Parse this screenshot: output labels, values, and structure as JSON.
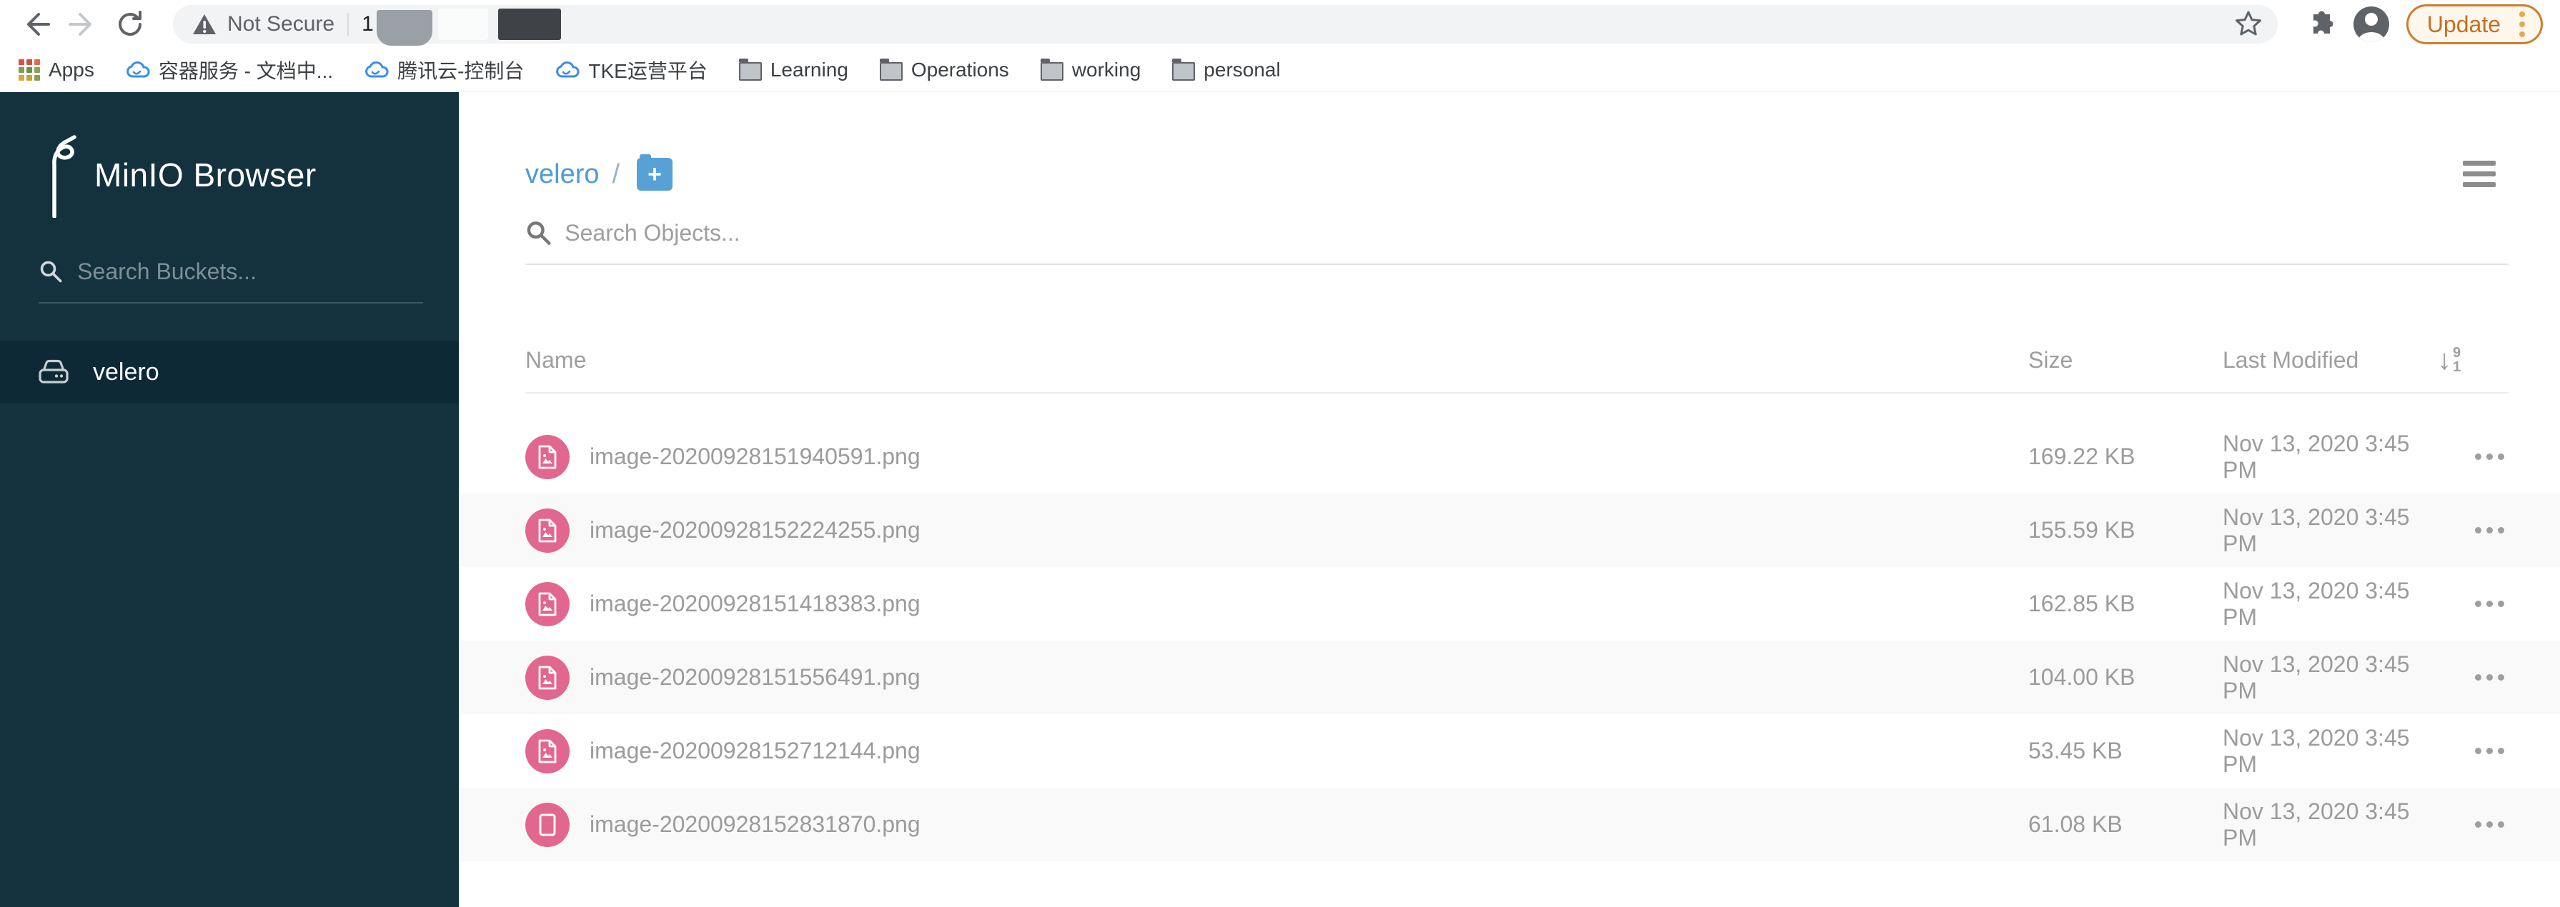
{
  "chrome": {
    "security_label": "Not Secure",
    "url_visible_fragment": "1",
    "update_button": "Update",
    "apps_label": "Apps",
    "bookmarks": [
      {
        "label": "容器服务 - 文档中...",
        "icon": "cloud"
      },
      {
        "label": "腾讯云-控制台",
        "icon": "cloud"
      },
      {
        "label": "TKE运营平台",
        "icon": "cloud"
      },
      {
        "label": "Learning",
        "icon": "folder"
      },
      {
        "label": "Operations",
        "icon": "folder"
      },
      {
        "label": "working",
        "icon": "folder"
      },
      {
        "label": "personal",
        "icon": "folder"
      }
    ]
  },
  "sidebar": {
    "title": "MinIO Browser",
    "search_placeholder": "Search Buckets...",
    "buckets": [
      {
        "name": "velero",
        "selected": true
      }
    ]
  },
  "main": {
    "breadcrumb": {
      "bucket": "velero",
      "separator": "/"
    },
    "search_placeholder": "Search Objects...",
    "table": {
      "headers": {
        "name": "Name",
        "size": "Size",
        "modified": "Last Modified"
      },
      "sort_icon": {
        "arrow": "↓",
        "top": "9",
        "bottom": "1"
      },
      "rows": [
        {
          "name": "image-20200928151940591.png",
          "size": "169.22 KB",
          "modified": "Nov 13, 2020 3:45 PM",
          "icon": "image-file"
        },
        {
          "name": "image-20200928152224255.png",
          "size": "155.59 KB",
          "modified": "Nov 13, 2020 3:45 PM",
          "icon": "image-file"
        },
        {
          "name": "image-20200928151418383.png",
          "size": "162.85 KB",
          "modified": "Nov 13, 2020 3:45 PM",
          "icon": "image-file"
        },
        {
          "name": "image-20200928151556491.png",
          "size": "104.00 KB",
          "modified": "Nov 13, 2020 3:45 PM",
          "icon": "image-file"
        },
        {
          "name": "image-20200928152712144.png",
          "size": "53.45 KB",
          "modified": "Nov 13, 2020 3:45 PM",
          "icon": "image-file"
        },
        {
          "name": "image-20200928152831870.png",
          "size": "61.08 KB",
          "modified": "Nov 13, 2020 3:45 PM",
          "icon": "plain-file"
        }
      ]
    }
  },
  "colors": {
    "sidebar_bg": "#13323e",
    "sidebar_selected_bg": "#0d2935",
    "accent_blue": "#4f9bd5",
    "object_icon_pink": "#e2678e",
    "update_orange": "#c86e1c",
    "muted_text": "#9b9b9b"
  }
}
